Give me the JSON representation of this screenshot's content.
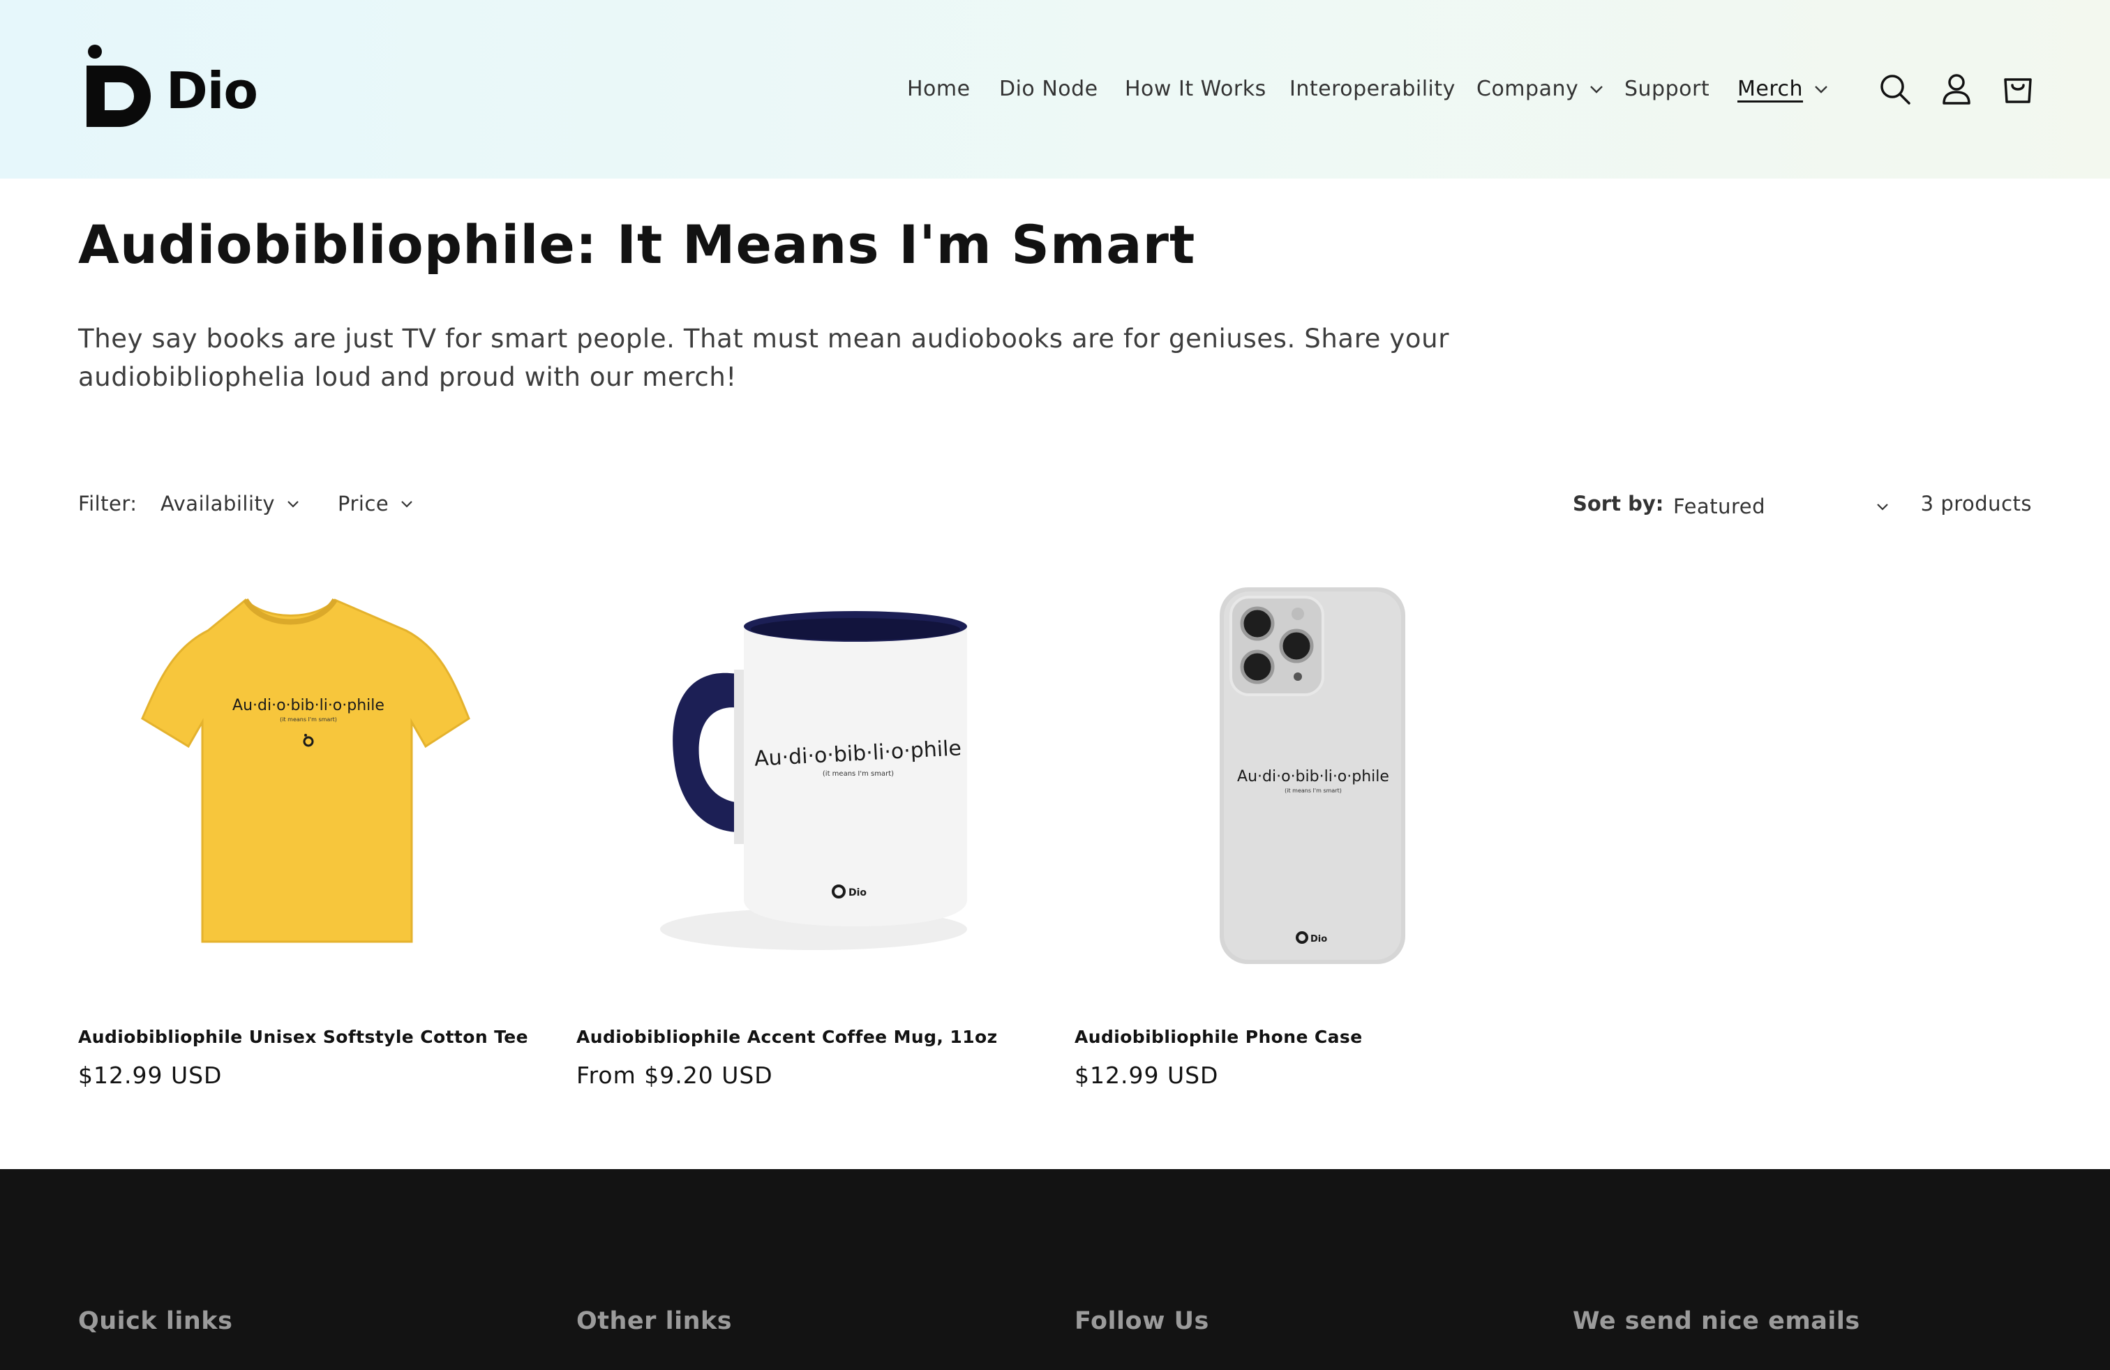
{
  "header": {
    "brand": "Dio",
    "nav": [
      {
        "label": "Home",
        "dropdown": false,
        "active": false
      },
      {
        "label": "Dio Node",
        "dropdown": false,
        "active": false
      },
      {
        "label": "How It Works",
        "dropdown": false,
        "active": false
      },
      {
        "label": "Interoperability",
        "dropdown": false,
        "active": false
      },
      {
        "label": "Company",
        "dropdown": true,
        "active": false
      },
      {
        "label": "Support",
        "dropdown": false,
        "active": false
      },
      {
        "label": "Merch",
        "dropdown": true,
        "active": true
      }
    ],
    "icons": [
      "search-icon",
      "account-icon",
      "cart-icon"
    ]
  },
  "collection": {
    "title": "Audiobibliophile: It Means I'm Smart",
    "description": "They say books are just TV for smart people. That must mean audiobooks are for geniuses. Share your audiobibliophelia loud and proud with our merch!"
  },
  "facets": {
    "filter_label": "Filter:",
    "filters": [
      "Availability",
      "Price"
    ],
    "sort_label": "Sort by:",
    "sort_value": "Featured",
    "count": "3 products"
  },
  "products": [
    {
      "title": "Audiobibliophile Unisex Softstyle Cotton Tee",
      "price": "$12.99 USD",
      "print_text": "Au·di·o·bib·li·o·phile",
      "print_sub": "(it means I'm smart)",
      "color": "#f7c63c"
    },
    {
      "title": "Audiobibliophile Accent Coffee Mug, 11oz",
      "price": "From $9.20 USD",
      "print_text": "Au·di·o·bib·li·o·phile",
      "print_sub": "(it means I'm smart)",
      "color": "#1c1f55"
    },
    {
      "title": "Audiobibliophile Phone Case",
      "price": "$12.99 USD",
      "print_text": "Au·di·o·bib·li·o·phile",
      "print_sub": "(it means I'm smart)",
      "color": "#d9d9d9"
    }
  ],
  "footer": {
    "headings": [
      "Quick links",
      "Other links",
      "Follow Us",
      "We send nice emails"
    ]
  }
}
